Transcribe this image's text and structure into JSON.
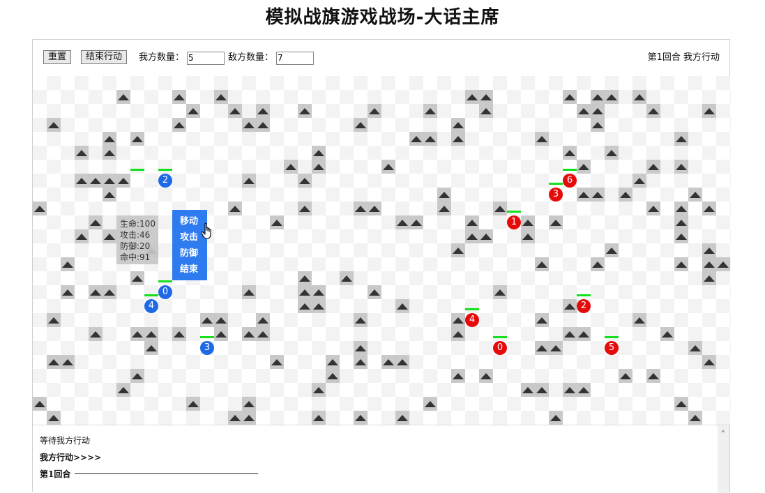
{
  "page": {
    "title": "模拟战旗游戏战场-大话主席"
  },
  "toolbar": {
    "reset_label": "重置",
    "end_turn_label": "结束行动",
    "ally_count_label": "我方数量：",
    "ally_count_value": "5",
    "enemy_count_label": "敌方数量：",
    "enemy_count_value": "7",
    "status": "第1回合   我方行动"
  },
  "board": {
    "cols": 50,
    "rows": 25,
    "mountains": [
      [
        6,
        1
      ],
      [
        10,
        1
      ],
      [
        13,
        1
      ],
      [
        31,
        1
      ],
      [
        32,
        1
      ],
      [
        38,
        1
      ],
      [
        40,
        1
      ],
      [
        41,
        1
      ],
      [
        43,
        1
      ],
      [
        11,
        2
      ],
      [
        14,
        2
      ],
      [
        16,
        2
      ],
      [
        19,
        2
      ],
      [
        24,
        2
      ],
      [
        28,
        2
      ],
      [
        32,
        2
      ],
      [
        39,
        2
      ],
      [
        40,
        2
      ],
      [
        44,
        2
      ],
      [
        48,
        2
      ],
      [
        1,
        3
      ],
      [
        10,
        3
      ],
      [
        15,
        3
      ],
      [
        16,
        3
      ],
      [
        23,
        3
      ],
      [
        30,
        3
      ],
      [
        40,
        3
      ],
      [
        5,
        4
      ],
      [
        7,
        4
      ],
      [
        27,
        4
      ],
      [
        28,
        4
      ],
      [
        30,
        4
      ],
      [
        36,
        4
      ],
      [
        46,
        4
      ],
      [
        3,
        5
      ],
      [
        5,
        5
      ],
      [
        20,
        5
      ],
      [
        38,
        5
      ],
      [
        41,
        5
      ],
      [
        18,
        6
      ],
      [
        20,
        6
      ],
      [
        25,
        6
      ],
      [
        39,
        6
      ],
      [
        44,
        6
      ],
      [
        46,
        6
      ],
      [
        3,
        7
      ],
      [
        4,
        7
      ],
      [
        5,
        7
      ],
      [
        6,
        7
      ],
      [
        15,
        7
      ],
      [
        19,
        7
      ],
      [
        43,
        7
      ],
      [
        5,
        8
      ],
      [
        29,
        8
      ],
      [
        39,
        8
      ],
      [
        40,
        8
      ],
      [
        42,
        8
      ],
      [
        47,
        8
      ],
      [
        0,
        9
      ],
      [
        14,
        9
      ],
      [
        19,
        9
      ],
      [
        23,
        9
      ],
      [
        24,
        9
      ],
      [
        29,
        9
      ],
      [
        33,
        9
      ],
      [
        44,
        9
      ],
      [
        46,
        9
      ],
      [
        48,
        9
      ],
      [
        4,
        10
      ],
      [
        17,
        10
      ],
      [
        26,
        10
      ],
      [
        27,
        10
      ],
      [
        31,
        10
      ],
      [
        35,
        10
      ],
      [
        37,
        10
      ],
      [
        46,
        10
      ],
      [
        3,
        11
      ],
      [
        5,
        11
      ],
      [
        31,
        11
      ],
      [
        32,
        11
      ],
      [
        35,
        11
      ],
      [
        46,
        11
      ],
      [
        8,
        12
      ],
      [
        30,
        12
      ],
      [
        41,
        12
      ],
      [
        48,
        12
      ],
      [
        2,
        13
      ],
      [
        11,
        13
      ],
      [
        36,
        13
      ],
      [
        40,
        13
      ],
      [
        46,
        13
      ],
      [
        48,
        13
      ],
      [
        49,
        13
      ],
      [
        7,
        14
      ],
      [
        19,
        14
      ],
      [
        22,
        14
      ],
      [
        48,
        14
      ],
      [
        2,
        15
      ],
      [
        4,
        15
      ],
      [
        5,
        15
      ],
      [
        15,
        15
      ],
      [
        19,
        15
      ],
      [
        20,
        15
      ],
      [
        24,
        15
      ],
      [
        33,
        15
      ],
      [
        19,
        16
      ],
      [
        20,
        16
      ],
      [
        26,
        16
      ],
      [
        38,
        16
      ],
      [
        1,
        17
      ],
      [
        12,
        17
      ],
      [
        13,
        17
      ],
      [
        16,
        17
      ],
      [
        23,
        17
      ],
      [
        30,
        17
      ],
      [
        36,
        17
      ],
      [
        43,
        17
      ],
      [
        4,
        18
      ],
      [
        7,
        18
      ],
      [
        8,
        18
      ],
      [
        10,
        18
      ],
      [
        13,
        18
      ],
      [
        15,
        18
      ],
      [
        16,
        18
      ],
      [
        30,
        18
      ],
      [
        38,
        18
      ],
      [
        39,
        18
      ],
      [
        45,
        18
      ],
      [
        8,
        19
      ],
      [
        23,
        19
      ],
      [
        36,
        19
      ],
      [
        37,
        19
      ],
      [
        47,
        19
      ],
      [
        1,
        20
      ],
      [
        2,
        20
      ],
      [
        17,
        20
      ],
      [
        21,
        20
      ],
      [
        23,
        20
      ],
      [
        25,
        20
      ],
      [
        26,
        20
      ],
      [
        48,
        20
      ],
      [
        7,
        21
      ],
      [
        21,
        21
      ],
      [
        30,
        21
      ],
      [
        32,
        21
      ],
      [
        42,
        21
      ],
      [
        44,
        21
      ],
      [
        6,
        22
      ],
      [
        20,
        22
      ],
      [
        35,
        22
      ],
      [
        36,
        22
      ],
      [
        38,
        22
      ],
      [
        39,
        22
      ],
      [
        0,
        23
      ],
      [
        11,
        23
      ],
      [
        15,
        23
      ],
      [
        28,
        23
      ],
      [
        46,
        23
      ],
      [
        1,
        24
      ],
      [
        14,
        24
      ],
      [
        15,
        24
      ],
      [
        20,
        24
      ],
      [
        23,
        24
      ],
      [
        26,
        24
      ],
      [
        37,
        24
      ],
      [
        47,
        24
      ]
    ],
    "allies": [
      {
        "label": "2",
        "col": 9,
        "row": 7
      },
      {
        "label": "0",
        "col": 9,
        "row": 15
      },
      {
        "label": "4",
        "col": 8,
        "row": 16
      },
      {
        "label": "3",
        "col": 12,
        "row": 19
      }
    ],
    "enemies": [
      {
        "label": "6",
        "col": 38,
        "row": 7
      },
      {
        "label": "3",
        "col": 37,
        "row": 8
      },
      {
        "label": "1",
        "col": 34,
        "row": 10
      },
      {
        "label": "2",
        "col": 39,
        "row": 16
      },
      {
        "label": "4",
        "col": 31,
        "row": 17
      },
      {
        "label": "0",
        "col": 33,
        "row": 19
      },
      {
        "label": "5",
        "col": 41,
        "row": 19
      }
    ],
    "health_bars": [
      {
        "col": 7,
        "row": 6,
        "hp": 1.0
      },
      {
        "col": 9,
        "row": 6,
        "hp": 1.0
      },
      {
        "col": 38,
        "row": 6,
        "hp": 1.0
      },
      {
        "col": 37,
        "row": 7,
        "hp": 1.0
      },
      {
        "col": 34,
        "row": 9,
        "hp": 1.0
      },
      {
        "col": 9,
        "row": 14,
        "hp": 1.0
      },
      {
        "col": 8,
        "row": 15,
        "hp": 1.0
      },
      {
        "col": 31,
        "row": 16,
        "hp": 1.0
      },
      {
        "col": 39,
        "row": 15,
        "hp": 1.0
      },
      {
        "col": 12,
        "row": 18,
        "hp": 1.0
      },
      {
        "col": 33,
        "row": 18,
        "hp": 1.0
      },
      {
        "col": 41,
        "row": 18,
        "hp": 1.0
      }
    ]
  },
  "unit_info": {
    "hp_line": "生命:100",
    "atk_line": "攻击:46",
    "def_line": "防御:20",
    "hit_line": "命中:91"
  },
  "action_menu": {
    "move": "移动",
    "attack": "攻击",
    "defend": "防御",
    "end": "结束"
  },
  "log": {
    "line1": "等待我方行动",
    "line2": "我方行动>>>>",
    "line3": "第1回合"
  },
  "colors": {
    "ally": "#1f69e6",
    "enemy": "#e50b0b",
    "health": "#14e11e",
    "menu": "#2e7bf0",
    "mountain_tile": "#c9c9c9"
  },
  "icons": [
    "mountain-icon",
    "pointer-hand-icon",
    "scroll-up-arrow-icon"
  ]
}
